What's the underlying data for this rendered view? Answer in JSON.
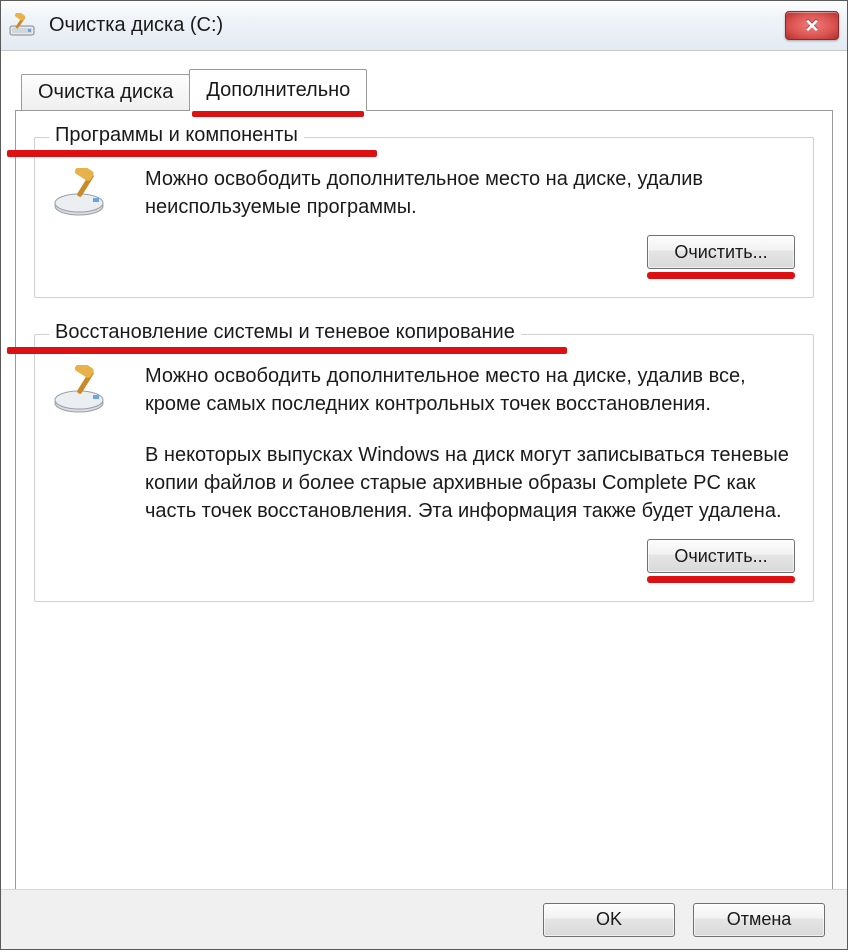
{
  "window": {
    "title": "Очистка диска  (C:)"
  },
  "tabs": {
    "cleanup": "Очистка диска",
    "additional": "Дополнительно"
  },
  "groups": {
    "programs": {
      "title": "Программы и компоненты",
      "text": "Можно освободить дополнительное место на диске, удалив неиспользуемые программы.",
      "button": "Очистить..."
    },
    "restore": {
      "title": "Восстановление системы и теневое копирование",
      "text1": "Можно освободить дополнительное место на диске, удалив все, кроме самых последних контрольных точек восстановления.",
      "text2": "В некоторых выпусках Windows на диск могут записываться теневые копии файлов и более старые архивные образы Complete PC как часть точек восстановления. Эта информация также будет удалена.",
      "button": "Очистить..."
    }
  },
  "buttons": {
    "ok": "OK",
    "cancel": "Отмена"
  }
}
